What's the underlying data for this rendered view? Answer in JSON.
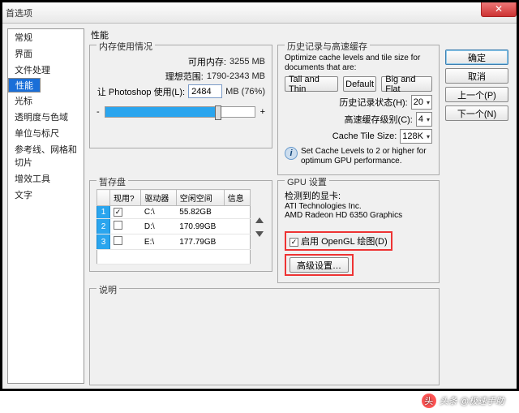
{
  "window": {
    "title": "首选项"
  },
  "sidebar": {
    "items": [
      "常规",
      "界面",
      "文件处理",
      "性能",
      "光标",
      "透明度与色域",
      "单位与标尺",
      "参考线、网格和切片",
      "增效工具",
      "文字"
    ],
    "selectedIndex": 3
  },
  "buttons": {
    "ok": "确定",
    "cancel": "取消",
    "prev": "上一个(P)",
    "next": "下一个(N)"
  },
  "page": {
    "title": "性能"
  },
  "mem": {
    "legend": "内存使用情况",
    "availLabel": "可用内存:",
    "availValue": "3255 MB",
    "idealLabel": "理想范围:",
    "idealValue": "1790-2343 MB",
    "psUseLabel": "让 Photoshop 使用(L):",
    "psUseValue": "2484",
    "psUseUnit": "MB (76%)",
    "minus": "-",
    "plus": "+",
    "sliderPercent": 76
  },
  "history": {
    "legend": "历史记录与高速缓存",
    "hint": "Optimize cache levels and tile size for documents that are:",
    "btnTall": "Tall and Thin",
    "btnDefault": "Default",
    "btnBig": "Big and Flat",
    "statesLabel": "历史记录状态(H):",
    "statesValue": "20",
    "levelsLabel": "高速缓存级别(C):",
    "levelsValue": "4",
    "tileLabel": "Cache Tile Size:",
    "tileValue": "128K",
    "infoText": "Set Cache Levels to 2 or higher for optimum GPU performance."
  },
  "scratch": {
    "legend": "暂存盘",
    "hdr": {
      "active": "现用?",
      "drive": "驱动器",
      "free": "空闲空间",
      "info": "信息"
    },
    "rows": [
      {
        "idx": "1",
        "active": true,
        "drive": "C:\\",
        "free": "55.82GB",
        "info": ""
      },
      {
        "idx": "2",
        "active": false,
        "drive": "D:\\",
        "free": "170.99GB",
        "info": ""
      },
      {
        "idx": "3",
        "active": false,
        "drive": "E:\\",
        "free": "177.79GB",
        "info": ""
      }
    ]
  },
  "gpu": {
    "legend": "GPU 设置",
    "detectedLabel": "检测到的显卡:",
    "vendor": "ATI Technologies Inc.",
    "card": "AMD Radeon HD 6350 Graphics",
    "enableLabel": "启用 OpenGL 绘图(D)",
    "enableChecked": true,
    "advBtn": "高级设置…"
  },
  "desc": {
    "legend": "说明"
  },
  "watermark": {
    "text": "头条 @极速手助"
  }
}
